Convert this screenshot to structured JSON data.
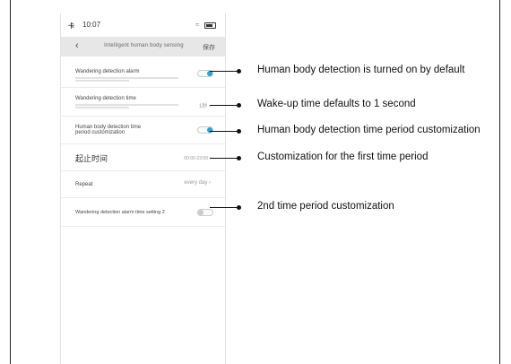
{
  "status_bar": {
    "signal": "卡",
    "time": "10:07",
    "wifi": "≈"
  },
  "nav": {
    "back_icon": "chevron-left",
    "title": "Intelligent human body sensing",
    "save_label": "保存"
  },
  "settings": {
    "wandering_alarm": {
      "label": "Wandering detection alarm",
      "enabled": true
    },
    "wandering_time": {
      "label": "Wandering detection time",
      "value": "1秒 ›"
    },
    "period_custom": {
      "label_line1": "Human body detection time",
      "label_line2": "period customization",
      "enabled": true
    },
    "start_end_time": {
      "label": "起止时间",
      "value": "00:00-23:59 ›"
    },
    "repeat": {
      "label": "Repeat",
      "value": "every day ›"
    },
    "alarm_time_2": {
      "label": "Wandering detection alarm time setting 2",
      "enabled": false
    }
  },
  "annotations": [
    "Human body detection is turned on by default",
    "Wake-up time defaults to 1 second",
    "Human body detection time period customization",
    "Customization for the first time period",
    "2nd time period customization"
  ]
}
